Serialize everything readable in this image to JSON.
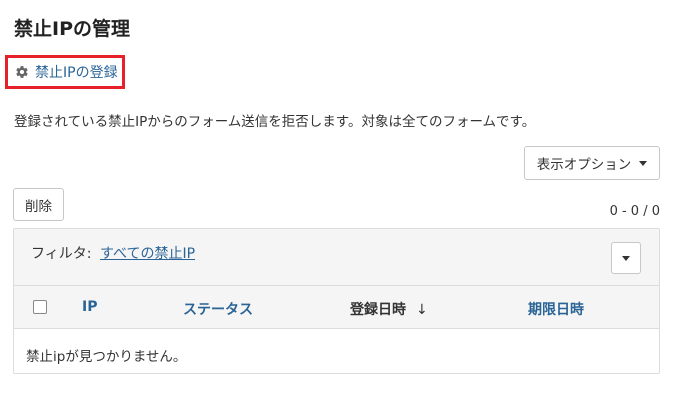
{
  "page": {
    "title": "禁止IPの管理"
  },
  "actions": {
    "register_label": "禁止IPの登録",
    "register_icon": "gear-icon"
  },
  "description": "登録されている禁止IPからのフォーム送信を拒否します。対象は全てのフォームです。",
  "toolbar": {
    "display_options_label": "表示オプション",
    "delete_label": "削除",
    "pagination_count": "0 - 0 / 0"
  },
  "filter": {
    "label": "フィルタ:",
    "value": "すべての禁止IP"
  },
  "table": {
    "columns": [
      "IP",
      "ステータス",
      "登録日時",
      "期限日時"
    ],
    "sort_indicator": "↓",
    "empty_message": "禁止ipが見つかりません。"
  },
  "colors": {
    "link": "#2a6496",
    "highlight_border": "#e8202a",
    "header_bg": "#f5f5f5"
  }
}
